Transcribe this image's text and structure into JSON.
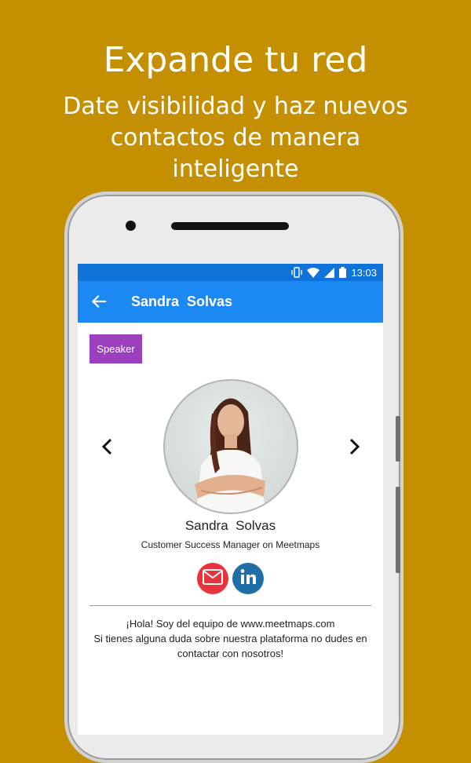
{
  "promo": {
    "headline": "Expande tu red",
    "subline": "Date visibilidad y haz nuevos contactos de manera inteligente"
  },
  "status_bar": {
    "time": "13:03",
    "icons": [
      "vibrate-icon",
      "wifi-icon",
      "signal-icon",
      "battery-icon"
    ]
  },
  "app_bar": {
    "title": "Sandra  Solvas",
    "back_icon": "arrow-back-icon"
  },
  "profile": {
    "badge": "Speaker",
    "name": "Sandra  Solvas",
    "role": "Customer Success Manager on Meetmaps",
    "bio_line1": "¡Hola! Soy del equipo de www.meetmaps.com",
    "bio_line2": "Si tienes alguna duda sobre nuestra plataforma no dudes en contactar con nosotros!"
  },
  "colors": {
    "background": "#c48f00",
    "status_bar": "#0f73d9",
    "app_bar": "#1c88f3",
    "badge": "#9b3fbf",
    "email_button": "#e8333a",
    "linkedin_button": "#1f6ea8"
  }
}
